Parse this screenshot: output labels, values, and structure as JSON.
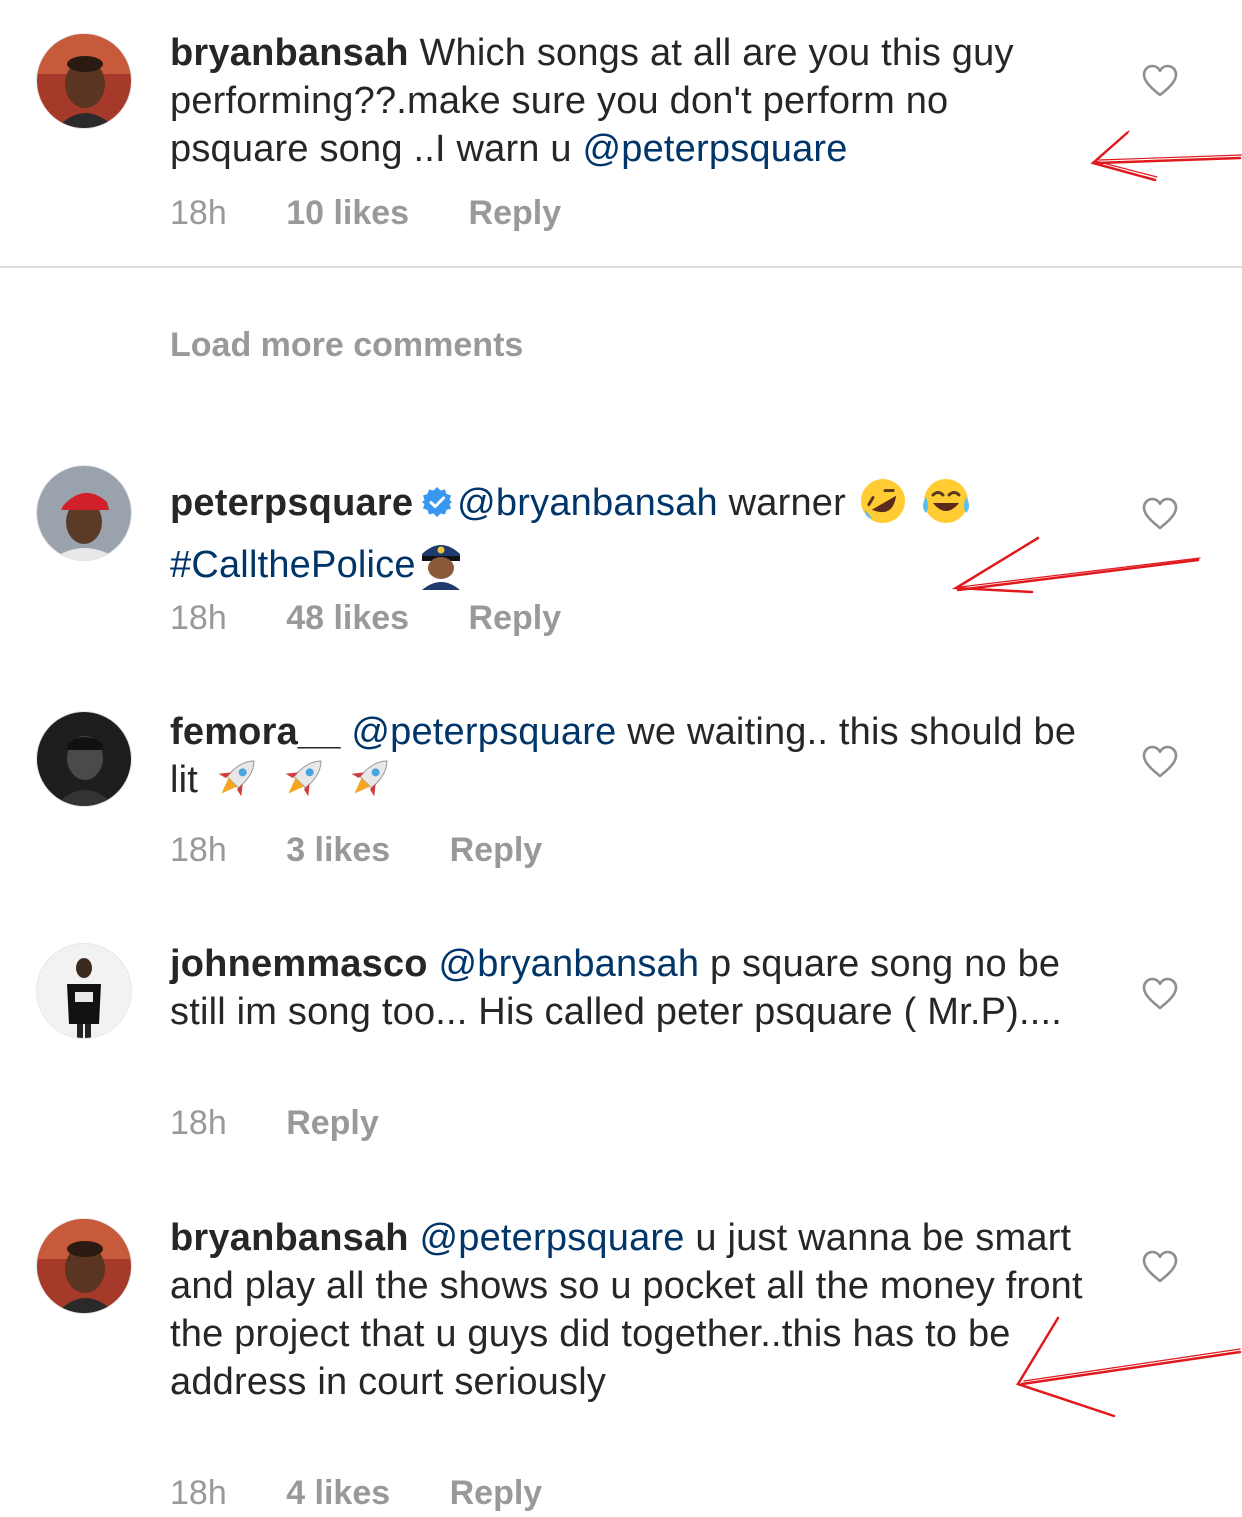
{
  "comments": [
    {
      "username": "bryanbansah",
      "text_parts": [
        "Which songs at all are you this guy performing??.make sure you don't perform no psquare song ..I warn u ",
        "@peterpsquare"
      ],
      "time": "18h",
      "likes": "10 likes",
      "reply": "Reply"
    },
    {
      "username": "peterpsquare",
      "mention": "@bryanbansah",
      "text": " warner ",
      "hashtag": "#CallthePolice",
      "emojis": [
        "rolling-on-floor-laughing",
        "tears-of-joy",
        "police-officer"
      ],
      "time": "18h",
      "likes": "48 likes",
      "reply": "Reply"
    },
    {
      "username": "femora__",
      "mention": "@peterpsquare",
      "text": " we waiting.. this should be lit ",
      "emojis": [
        "rocket",
        "rocket",
        "rocket"
      ],
      "time": "18h",
      "likes": "3 likes",
      "reply": "Reply"
    },
    {
      "username": "johnemmasco",
      "mention": "@bryanbansah",
      "text": " p square song no be still im song too... His called peter psquare ( Mr.P)....",
      "time": "18h",
      "reply": "Reply"
    },
    {
      "username": "bryanbansah",
      "mention": "@peterpsquare",
      "text": " u just wanna be smart and play all the shows so u pocket all the money front the project that u guys did together..this has to be address in court seriously",
      "time": "18h",
      "likes": "4 likes",
      "reply": "Reply"
    }
  ],
  "load_more": "Load more comments",
  "icons": {
    "like": "heart-outline-icon",
    "verified": "verified-badge-icon"
  },
  "colors": {
    "text": "#262626",
    "mention": "#003569",
    "meta": "#999999",
    "annotation_arrow": "#e0191e"
  }
}
